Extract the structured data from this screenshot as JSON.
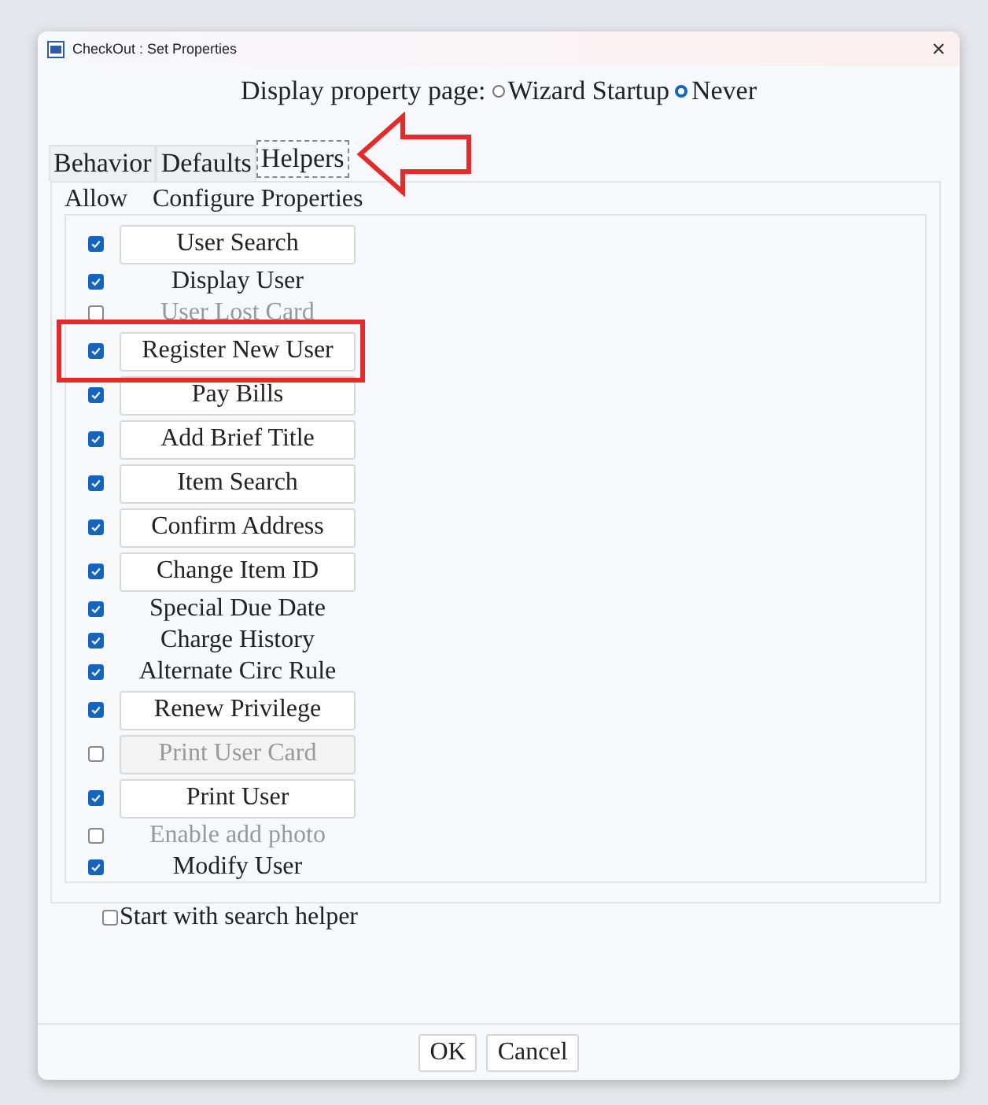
{
  "window": {
    "title": "CheckOut : Set Properties",
    "close": "×"
  },
  "display_property_page": {
    "label": "Display property page:",
    "options": [
      {
        "label": "Wizard Startup",
        "selected": false
      },
      {
        "label": "Never",
        "selected": true
      }
    ]
  },
  "tabs": [
    {
      "label": "Behavior",
      "selected": false,
      "pointed": false
    },
    {
      "label": "Defaults",
      "selected": false,
      "pointed": false
    },
    {
      "label": "Helpers",
      "selected": true,
      "pointed": true
    }
  ],
  "helpers": {
    "column_allow": "Allow",
    "column_configure": "Configure Properties",
    "items": [
      {
        "kind": "button",
        "label": "User Search",
        "checked": true,
        "disabled": false,
        "highlighted": false
      },
      {
        "kind": "label",
        "label": "Display User",
        "checked": true,
        "disabled": false,
        "highlighted": false
      },
      {
        "kind": "label",
        "label": "User Lost Card",
        "checked": false,
        "disabled": true,
        "highlighted": false
      },
      {
        "kind": "button",
        "label": "Register New User",
        "checked": true,
        "disabled": false,
        "highlighted": true
      },
      {
        "kind": "button",
        "label": "Pay Bills",
        "checked": true,
        "disabled": false,
        "highlighted": false
      },
      {
        "kind": "button",
        "label": "Add Brief Title",
        "checked": true,
        "disabled": false,
        "highlighted": false
      },
      {
        "kind": "button",
        "label": "Item Search",
        "checked": true,
        "disabled": false,
        "highlighted": false
      },
      {
        "kind": "button",
        "label": "Confirm Address",
        "checked": true,
        "disabled": false,
        "highlighted": false
      },
      {
        "kind": "button",
        "label": "Change Item ID",
        "checked": true,
        "disabled": false,
        "highlighted": false
      },
      {
        "kind": "label",
        "label": "Special Due Date",
        "checked": true,
        "disabled": false,
        "highlighted": false
      },
      {
        "kind": "label",
        "label": "Charge History",
        "checked": true,
        "disabled": false,
        "highlighted": false
      },
      {
        "kind": "label",
        "label": "Alternate Circ Rule",
        "checked": true,
        "disabled": false,
        "highlighted": false
      },
      {
        "kind": "button",
        "label": "Renew Privilege",
        "checked": true,
        "disabled": false,
        "highlighted": false
      },
      {
        "kind": "button",
        "label": "Print User Card",
        "checked": false,
        "disabled": true,
        "highlighted": false
      },
      {
        "kind": "button",
        "label": "Print User",
        "checked": true,
        "disabled": false,
        "highlighted": false
      },
      {
        "kind": "label",
        "label": "Enable add photo",
        "checked": false,
        "disabled": true,
        "highlighted": false
      },
      {
        "kind": "label",
        "label": "Modify User",
        "checked": true,
        "disabled": false,
        "highlighted": false
      }
    ]
  },
  "start_with_search_helper": {
    "label": "Start with search helper",
    "checked": false
  },
  "buttons": [
    {
      "label": "OK"
    },
    {
      "label": "Cancel"
    }
  ]
}
